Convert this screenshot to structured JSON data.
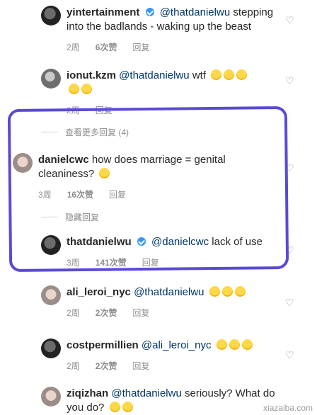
{
  "comments": [
    {
      "user": "yintertainment",
      "verified": true,
      "mention": "@thatdanielwu",
      "text": "stepping into the badlands - waking up the beast",
      "time": "2周",
      "likes": "6次赞",
      "reply": "回复",
      "emoji_count": 0
    },
    {
      "user": "ionut.kzm",
      "verified": false,
      "mention": "@thatdanielwu",
      "text": "wtf",
      "time": "2周",
      "likes": "",
      "reply": "回复",
      "emoji_count": 5
    },
    {
      "thread_more": "查看更多回复 (4)"
    },
    {
      "user": "danielcwc",
      "verified": false,
      "mention": "",
      "text": "how does marriage = genital cleaniness?",
      "time": "3周",
      "likes": "16次赞",
      "reply": "回复",
      "emoji_count": 1
    },
    {
      "thread_hide": "隐藏回复"
    },
    {
      "user": "thatdanielwu",
      "verified": true,
      "mention": "@danielcwc",
      "text": "lack of use",
      "time": "3周",
      "likes": "141次赞",
      "reply": "回复",
      "emoji_count": 0
    },
    {
      "user": "ali_leroi_nyc",
      "verified": false,
      "mention": "@thatdanielwu",
      "text": "",
      "time": "2周",
      "likes": "2次赞",
      "reply": "回复",
      "emoji_count": 3
    },
    {
      "user": "costpermillien",
      "verified": false,
      "mention": "@ali_leroi_nyc",
      "text": "",
      "time": "2周",
      "likes": "2次赞",
      "reply": "回复",
      "emoji_count": 3
    },
    {
      "user": "ziqizhan",
      "verified": false,
      "mention": "@thatdanielwu",
      "text": "seriously? What do you do?",
      "time": "",
      "likes": "",
      "reply": "",
      "emoji_count": 2
    }
  ],
  "icons": {
    "heart": "heart-icon",
    "verified": "verified-badge-icon",
    "emoji": "emoji-icon"
  },
  "annotation_color": "#5a4ad6",
  "watermark": "xiazaiba.com"
}
